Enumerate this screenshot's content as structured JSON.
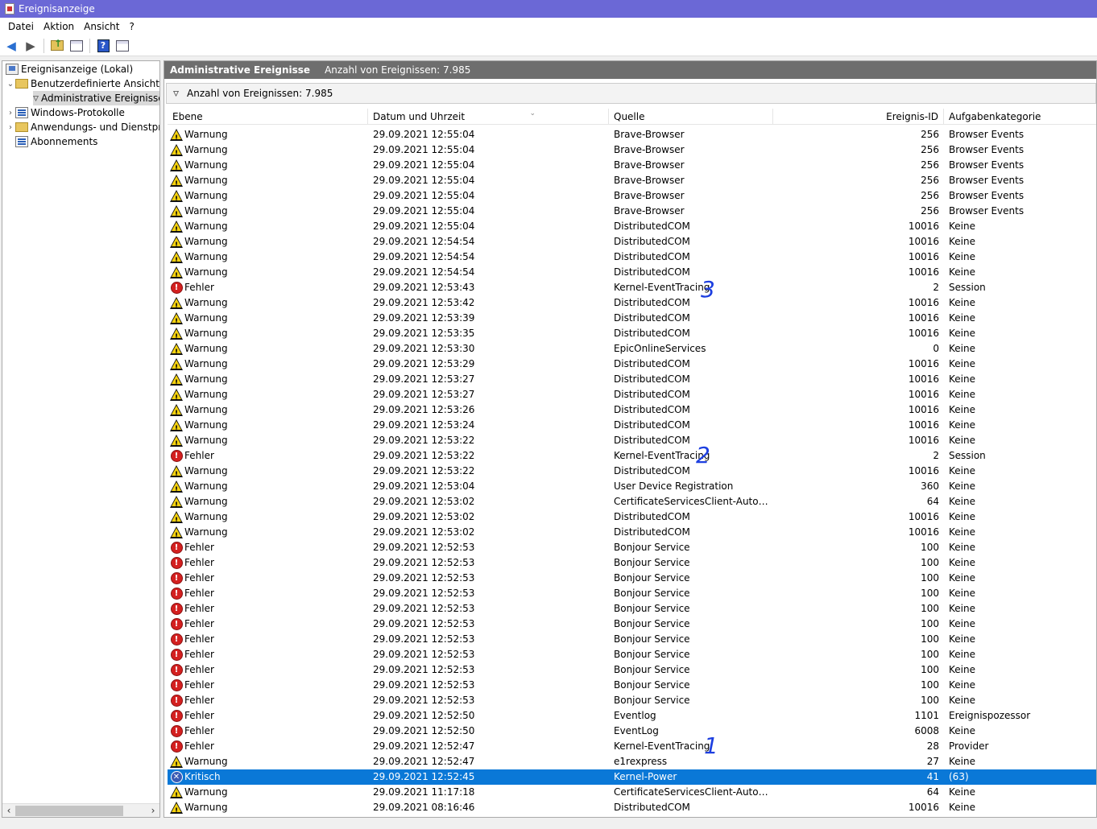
{
  "window": {
    "title": "Ereignisanzeige"
  },
  "menu": [
    "Datei",
    "Aktion",
    "Ansicht",
    "?"
  ],
  "tree": {
    "root": "Ereignisanzeige (Lokal)",
    "custom_views": "Benutzerdefinierte Ansichten",
    "admin_events": "Administrative Ereignisse",
    "windows_logs": "Windows-Protokolle",
    "app_logs": "Anwendungs- und Dienstprotokolle",
    "subscriptions": "Abonnements"
  },
  "main": {
    "title": "Administrative Ereignisse",
    "count_label": "Anzahl von Ereignissen: 7.985",
    "filter_label": "Anzahl von Ereignissen: 7.985"
  },
  "columns": [
    "Ebene",
    "Datum und Uhrzeit",
    "Quelle",
    "Ereignis-ID",
    "Aufgabenkategorie"
  ],
  "events": [
    {
      "level": "Warnung",
      "type": "warn",
      "date": "29.09.2021 12:55:04",
      "source": "Brave-Browser",
      "id": "256",
      "cat": "Browser Events"
    },
    {
      "level": "Warnung",
      "type": "warn",
      "date": "29.09.2021 12:55:04",
      "source": "Brave-Browser",
      "id": "256",
      "cat": "Browser Events"
    },
    {
      "level": "Warnung",
      "type": "warn",
      "date": "29.09.2021 12:55:04",
      "source": "Brave-Browser",
      "id": "256",
      "cat": "Browser Events"
    },
    {
      "level": "Warnung",
      "type": "warn",
      "date": "29.09.2021 12:55:04",
      "source": "Brave-Browser",
      "id": "256",
      "cat": "Browser Events"
    },
    {
      "level": "Warnung",
      "type": "warn",
      "date": "29.09.2021 12:55:04",
      "source": "Brave-Browser",
      "id": "256",
      "cat": "Browser Events"
    },
    {
      "level": "Warnung",
      "type": "warn",
      "date": "29.09.2021 12:55:04",
      "source": "Brave-Browser",
      "id": "256",
      "cat": "Browser Events"
    },
    {
      "level": "Warnung",
      "type": "warn",
      "date": "29.09.2021 12:55:04",
      "source": "DistributedCOM",
      "id": "10016",
      "cat": "Keine"
    },
    {
      "level": "Warnung",
      "type": "warn",
      "date": "29.09.2021 12:54:54",
      "source": "DistributedCOM",
      "id": "10016",
      "cat": "Keine"
    },
    {
      "level": "Warnung",
      "type": "warn",
      "date": "29.09.2021 12:54:54",
      "source": "DistributedCOM",
      "id": "10016",
      "cat": "Keine"
    },
    {
      "level": "Warnung",
      "type": "warn",
      "date": "29.09.2021 12:54:54",
      "source": "DistributedCOM",
      "id": "10016",
      "cat": "Keine"
    },
    {
      "level": "Fehler",
      "type": "err",
      "date": "29.09.2021 12:53:43",
      "source": "Kernel-EventTracing",
      "id": "2",
      "cat": "Session"
    },
    {
      "level": "Warnung",
      "type": "warn",
      "date": "29.09.2021 12:53:42",
      "source": "DistributedCOM",
      "id": "10016",
      "cat": "Keine"
    },
    {
      "level": "Warnung",
      "type": "warn",
      "date": "29.09.2021 12:53:39",
      "source": "DistributedCOM",
      "id": "10016",
      "cat": "Keine"
    },
    {
      "level": "Warnung",
      "type": "warn",
      "date": "29.09.2021 12:53:35",
      "source": "DistributedCOM",
      "id": "10016",
      "cat": "Keine"
    },
    {
      "level": "Warnung",
      "type": "warn",
      "date": "29.09.2021 12:53:30",
      "source": "EpicOnlineServices",
      "id": "0",
      "cat": "Keine"
    },
    {
      "level": "Warnung",
      "type": "warn",
      "date": "29.09.2021 12:53:29",
      "source": "DistributedCOM",
      "id": "10016",
      "cat": "Keine"
    },
    {
      "level": "Warnung",
      "type": "warn",
      "date": "29.09.2021 12:53:27",
      "source": "DistributedCOM",
      "id": "10016",
      "cat": "Keine"
    },
    {
      "level": "Warnung",
      "type": "warn",
      "date": "29.09.2021 12:53:27",
      "source": "DistributedCOM",
      "id": "10016",
      "cat": "Keine"
    },
    {
      "level": "Warnung",
      "type": "warn",
      "date": "29.09.2021 12:53:26",
      "source": "DistributedCOM",
      "id": "10016",
      "cat": "Keine"
    },
    {
      "level": "Warnung",
      "type": "warn",
      "date": "29.09.2021 12:53:24",
      "source": "DistributedCOM",
      "id": "10016",
      "cat": "Keine"
    },
    {
      "level": "Warnung",
      "type": "warn",
      "date": "29.09.2021 12:53:22",
      "source": "DistributedCOM",
      "id": "10016",
      "cat": "Keine"
    },
    {
      "level": "Fehler",
      "type": "err",
      "date": "29.09.2021 12:53:22",
      "source": "Kernel-EventTracing",
      "id": "2",
      "cat": "Session"
    },
    {
      "level": "Warnung",
      "type": "warn",
      "date": "29.09.2021 12:53:22",
      "source": "DistributedCOM",
      "id": "10016",
      "cat": "Keine"
    },
    {
      "level": "Warnung",
      "type": "warn",
      "date": "29.09.2021 12:53:04",
      "source": "User Device Registration",
      "id": "360",
      "cat": "Keine"
    },
    {
      "level": "Warnung",
      "type": "warn",
      "date": "29.09.2021 12:53:02",
      "source": "CertificateServicesClient-AutoEnroll...",
      "id": "64",
      "cat": "Keine"
    },
    {
      "level": "Warnung",
      "type": "warn",
      "date": "29.09.2021 12:53:02",
      "source": "DistributedCOM",
      "id": "10016",
      "cat": "Keine"
    },
    {
      "level": "Warnung",
      "type": "warn",
      "date": "29.09.2021 12:53:02",
      "source": "DistributedCOM",
      "id": "10016",
      "cat": "Keine"
    },
    {
      "level": "Fehler",
      "type": "err",
      "date": "29.09.2021 12:52:53",
      "source": "Bonjour Service",
      "id": "100",
      "cat": "Keine"
    },
    {
      "level": "Fehler",
      "type": "err",
      "date": "29.09.2021 12:52:53",
      "source": "Bonjour Service",
      "id": "100",
      "cat": "Keine"
    },
    {
      "level": "Fehler",
      "type": "err",
      "date": "29.09.2021 12:52:53",
      "source": "Bonjour Service",
      "id": "100",
      "cat": "Keine"
    },
    {
      "level": "Fehler",
      "type": "err",
      "date": "29.09.2021 12:52:53",
      "source": "Bonjour Service",
      "id": "100",
      "cat": "Keine"
    },
    {
      "level": "Fehler",
      "type": "err",
      "date": "29.09.2021 12:52:53",
      "source": "Bonjour Service",
      "id": "100",
      "cat": "Keine"
    },
    {
      "level": "Fehler",
      "type": "err",
      "date": "29.09.2021 12:52:53",
      "source": "Bonjour Service",
      "id": "100",
      "cat": "Keine"
    },
    {
      "level": "Fehler",
      "type": "err",
      "date": "29.09.2021 12:52:53",
      "source": "Bonjour Service",
      "id": "100",
      "cat": "Keine"
    },
    {
      "level": "Fehler",
      "type": "err",
      "date": "29.09.2021 12:52:53",
      "source": "Bonjour Service",
      "id": "100",
      "cat": "Keine"
    },
    {
      "level": "Fehler",
      "type": "err",
      "date": "29.09.2021 12:52:53",
      "source": "Bonjour Service",
      "id": "100",
      "cat": "Keine"
    },
    {
      "level": "Fehler",
      "type": "err",
      "date": "29.09.2021 12:52:53",
      "source": "Bonjour Service",
      "id": "100",
      "cat": "Keine"
    },
    {
      "level": "Fehler",
      "type": "err",
      "date": "29.09.2021 12:52:53",
      "source": "Bonjour Service",
      "id": "100",
      "cat": "Keine"
    },
    {
      "level": "Fehler",
      "type": "err",
      "date": "29.09.2021 12:52:50",
      "source": "Eventlog",
      "id": "1101",
      "cat": "Ereignispozessor"
    },
    {
      "level": "Fehler",
      "type": "err",
      "date": "29.09.2021 12:52:50",
      "source": "EventLog",
      "id": "6008",
      "cat": "Keine"
    },
    {
      "level": "Fehler",
      "type": "err",
      "date": "29.09.2021 12:52:47",
      "source": "Kernel-EventTracing",
      "id": "28",
      "cat": "Provider"
    },
    {
      "level": "Warnung",
      "type": "warn",
      "date": "29.09.2021 12:52:47",
      "source": "e1rexpress",
      "id": "27",
      "cat": "Keine"
    },
    {
      "level": "Kritisch",
      "type": "crit",
      "date": "29.09.2021 12:52:45",
      "source": "Kernel-Power",
      "id": "41",
      "cat": "(63)",
      "selected": true
    },
    {
      "level": "Warnung",
      "type": "warn",
      "date": "29.09.2021 11:17:18",
      "source": "CertificateServicesClient-AutoEnroll...",
      "id": "64",
      "cat": "Keine"
    },
    {
      "level": "Warnung",
      "type": "warn",
      "date": "29.09.2021 08:16:46",
      "source": "DistributedCOM",
      "id": "10016",
      "cat": "Keine"
    }
  ],
  "annotations": [
    "3",
    "2",
    "1"
  ]
}
